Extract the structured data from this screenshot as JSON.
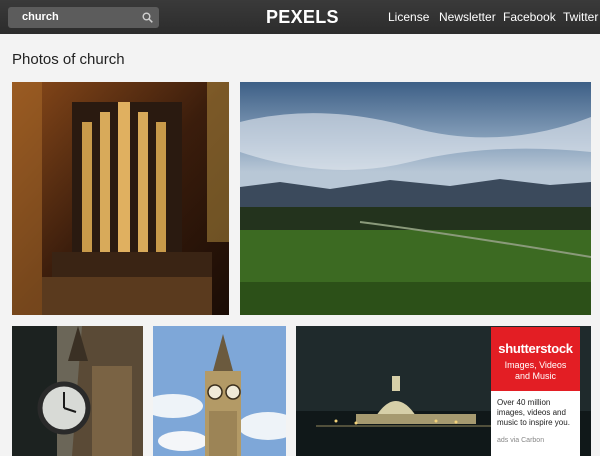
{
  "header": {
    "search_value": "church",
    "logo": "PEXELS",
    "nav": [
      "License",
      "Newsletter",
      "Facebook",
      "Twitter"
    ]
  },
  "main": {
    "title": "Photos of church"
  },
  "ad": {
    "brand": "shutterstock",
    "tagline_1": "Images, Videos",
    "tagline_2": "and Music",
    "body": "Over 40 million images, videos and music to inspire you.",
    "via": "ads via Carbon",
    "accent": "#e31e24"
  },
  "colors": {
    "topbar": "#2c2c2c",
    "page_bg": "#f3f3f3"
  }
}
